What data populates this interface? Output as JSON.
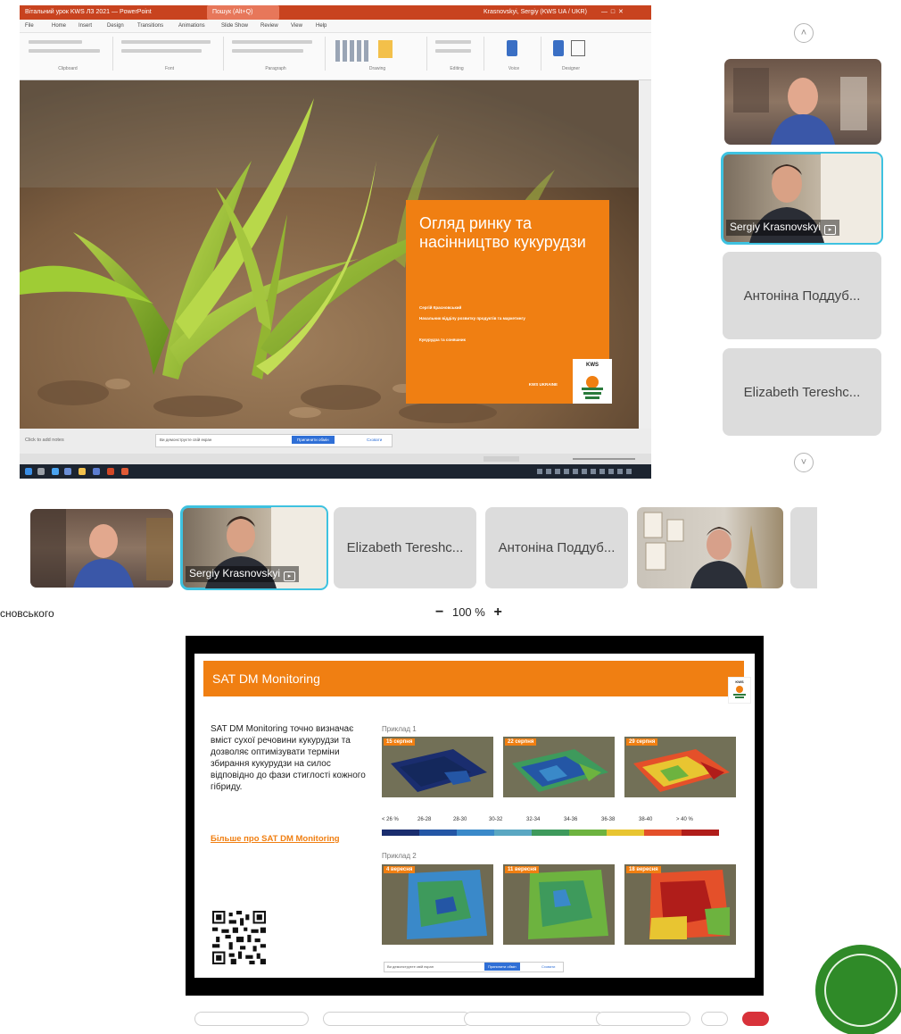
{
  "ppt_window": {
    "title_left": "Вітальний урок KWS ЛЗ 2021 — PowerPoint",
    "title_search": "Пошук (Alt+Q)",
    "title_user": "Krasnovskyi, Sergiy (KWS UA / UKR)",
    "menu_items": [
      "File",
      "Home",
      "Insert",
      "Design",
      "Transitions",
      "Animations",
      "Slide Show",
      "Review",
      "View",
      "Help"
    ],
    "ribbon_groups": [
      "Clipboard",
      "Font",
      "Paragraph",
      "Drawing",
      "Editing",
      "Voice",
      "Designer"
    ],
    "notes_placeholder": "Click to add notes",
    "notification_text": "Ви демонструєте свій екран",
    "notification_primary": "Припинити обмін",
    "notification_secondary": "Сховати"
  },
  "main_slide": {
    "title": "Огляд ринку та насінництво кукурудзи",
    "presenter": "Сергій Красновський",
    "role": "Начальник відділу розвитку продуктів та маркетингу",
    "role2": "Кукурудза та соняшник",
    "footer": "KWS UKRAINE",
    "logo": "KWS"
  },
  "right_panel": {
    "participants": [
      {
        "name": "",
        "type": "video"
      },
      {
        "name": "Sergiy Krasnovskyi",
        "type": "video",
        "selected": true
      },
      {
        "name": "Антоніна Поддуб...",
        "type": "name"
      },
      {
        "name": "Elizabeth Tereshc...",
        "type": "name"
      }
    ]
  },
  "strip": {
    "participants": [
      {
        "name": "",
        "type": "video"
      },
      {
        "name": "Sergiy Krasnovskyi",
        "type": "video",
        "selected": true
      },
      {
        "name": "Elizabeth Tereshc...",
        "type": "name"
      },
      {
        "name": "Антоніна Поддуб...",
        "type": "name"
      },
      {
        "name": "",
        "type": "video"
      }
    ]
  },
  "viewer": {
    "name_fragment": "сновського",
    "zoom_minus": "−",
    "zoom_level": "100 %",
    "zoom_plus": "+"
  },
  "sat_slide": {
    "title": "SAT DM Monitoring",
    "logo": "KWS",
    "description": "SAT DM Monitoring точно визначає вміст сухої речовини кукурудзи та дозволяє оптимізувати терміни збирання кукурудзи на силос відповідно до фази стиглості кожного гібриду.",
    "link": "Більше про SAT DM Monitoring",
    "example1_label": "Приклад 1",
    "example2_label": "Приклад 2",
    "example1_dates": [
      "15 серпня",
      "22 серпня",
      "29 серпня"
    ],
    "example2_dates": [
      "4 вересня",
      "11 вересня",
      "18 вересня"
    ],
    "legend": [
      {
        "label": "< 26 %",
        "color": "#1a2d6e"
      },
      {
        "label": "26-28",
        "color": "#2456a5"
      },
      {
        "label": "28-30",
        "color": "#3a89c9"
      },
      {
        "label": "30-32",
        "color": "#5aa7c2"
      },
      {
        "label": "32-34",
        "color": "#3e9a5c"
      },
      {
        "label": "34-36",
        "color": "#6db33f"
      },
      {
        "label": "36-38",
        "color": "#e8c531"
      },
      {
        "label": "38-40",
        "color": "#e4502a"
      },
      {
        "label": "> 40 %",
        "color": "#b01d1a"
      }
    ],
    "notification_text": "Ви демонструєте свій екран",
    "notification_primary": "Припинити обмін",
    "notification_secondary": "Сховати"
  },
  "colors": {
    "accent_orange": "#f07f12",
    "selected_outline": "#3ec2e0",
    "record_green": "#2f8a28",
    "ppt_red": "#c8431f"
  },
  "icons": {
    "scroll_up": "chevron-up-icon",
    "scroll_down": "chevron-down-icon",
    "pin": "pin-icon"
  }
}
